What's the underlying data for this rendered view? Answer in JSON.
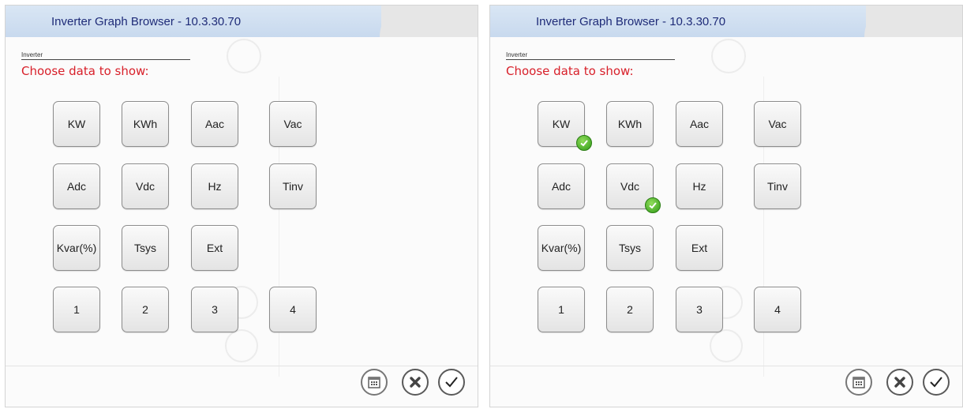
{
  "panels": [
    {
      "title": "Inverter Graph Browser - 10.3.30.70",
      "small_label": "Inverter",
      "prompt": "Choose data to show:",
      "buttons": [
        {
          "label": "KW",
          "checked": false
        },
        {
          "label": "KWh",
          "checked": false
        },
        {
          "label": "Aac",
          "checked": false
        },
        {
          "label": "Vac",
          "checked": false
        },
        {
          "label": "Adc",
          "checked": false
        },
        {
          "label": "Vdc",
          "checked": false
        },
        {
          "label": "Hz",
          "checked": false
        },
        {
          "label": "Tinv",
          "checked": false
        },
        {
          "label": "Kvar(%)",
          "checked": false
        },
        {
          "label": "Tsys",
          "checked": false
        },
        {
          "label": "Ext",
          "checked": false
        },
        {
          "label": "1",
          "checked": false
        },
        {
          "label": "2",
          "checked": false
        },
        {
          "label": "3",
          "checked": false
        },
        {
          "label": "4",
          "checked": false
        }
      ]
    },
    {
      "title": "Inverter Graph Browser - 10.3.30.70",
      "small_label": "Inverter",
      "prompt": "Choose data to show:",
      "buttons": [
        {
          "label": "KW",
          "checked": true
        },
        {
          "label": "KWh",
          "checked": false
        },
        {
          "label": "Aac",
          "checked": false
        },
        {
          "label": "Vac",
          "checked": false
        },
        {
          "label": "Adc",
          "checked": false
        },
        {
          "label": "Vdc",
          "checked": true
        },
        {
          "label": "Hz",
          "checked": false
        },
        {
          "label": "Tinv",
          "checked": false
        },
        {
          "label": "Kvar(%)",
          "checked": false
        },
        {
          "label": "Tsys",
          "checked": false
        },
        {
          "label": "Ext",
          "checked": false
        },
        {
          "label": "1",
          "checked": false
        },
        {
          "label": "2",
          "checked": false
        },
        {
          "label": "3",
          "checked": false
        },
        {
          "label": "4",
          "checked": false
        }
      ]
    }
  ],
  "icons": {
    "calendar": "calendar-icon",
    "cancel": "cancel-icon",
    "confirm": "checkmark-icon"
  },
  "colors": {
    "title_bar": "#c8d9ee",
    "title_text": "#1e2b78",
    "prompt_text": "#d8202a",
    "check_badge": "#2f9a17"
  }
}
